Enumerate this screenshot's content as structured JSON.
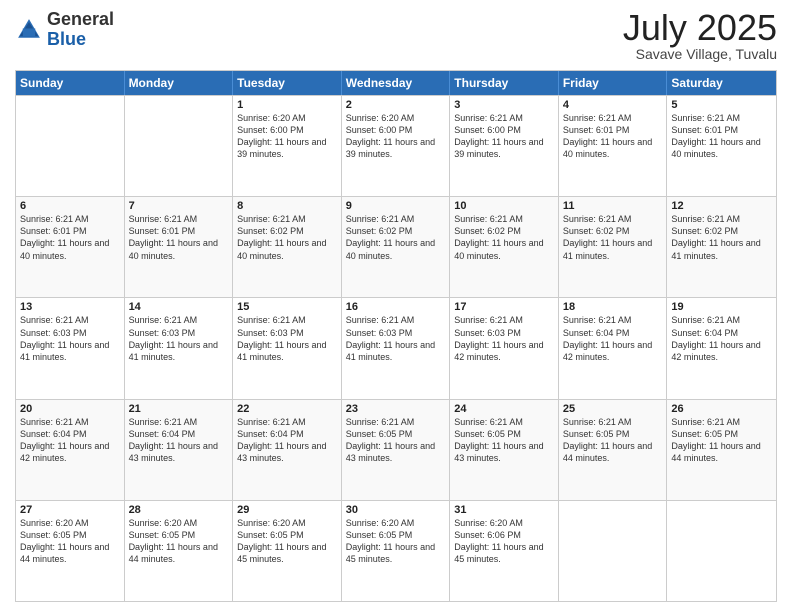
{
  "header": {
    "logo_general": "General",
    "logo_blue": "Blue",
    "month_year": "July 2025",
    "location": "Savave Village, Tuvalu"
  },
  "days_of_week": [
    "Sunday",
    "Monday",
    "Tuesday",
    "Wednesday",
    "Thursday",
    "Friday",
    "Saturday"
  ],
  "weeks": [
    [
      {
        "day": "",
        "sunrise": "",
        "sunset": "",
        "daylight": ""
      },
      {
        "day": "",
        "sunrise": "",
        "sunset": "",
        "daylight": ""
      },
      {
        "day": "1",
        "sunrise": "Sunrise: 6:20 AM",
        "sunset": "Sunset: 6:00 PM",
        "daylight": "Daylight: 11 hours and 39 minutes."
      },
      {
        "day": "2",
        "sunrise": "Sunrise: 6:20 AM",
        "sunset": "Sunset: 6:00 PM",
        "daylight": "Daylight: 11 hours and 39 minutes."
      },
      {
        "day": "3",
        "sunrise": "Sunrise: 6:21 AM",
        "sunset": "Sunset: 6:00 PM",
        "daylight": "Daylight: 11 hours and 39 minutes."
      },
      {
        "day": "4",
        "sunrise": "Sunrise: 6:21 AM",
        "sunset": "Sunset: 6:01 PM",
        "daylight": "Daylight: 11 hours and 40 minutes."
      },
      {
        "day": "5",
        "sunrise": "Sunrise: 6:21 AM",
        "sunset": "Sunset: 6:01 PM",
        "daylight": "Daylight: 11 hours and 40 minutes."
      }
    ],
    [
      {
        "day": "6",
        "sunrise": "Sunrise: 6:21 AM",
        "sunset": "Sunset: 6:01 PM",
        "daylight": "Daylight: 11 hours and 40 minutes."
      },
      {
        "day": "7",
        "sunrise": "Sunrise: 6:21 AM",
        "sunset": "Sunset: 6:01 PM",
        "daylight": "Daylight: 11 hours and 40 minutes."
      },
      {
        "day": "8",
        "sunrise": "Sunrise: 6:21 AM",
        "sunset": "Sunset: 6:02 PM",
        "daylight": "Daylight: 11 hours and 40 minutes."
      },
      {
        "day": "9",
        "sunrise": "Sunrise: 6:21 AM",
        "sunset": "Sunset: 6:02 PM",
        "daylight": "Daylight: 11 hours and 40 minutes."
      },
      {
        "day": "10",
        "sunrise": "Sunrise: 6:21 AM",
        "sunset": "Sunset: 6:02 PM",
        "daylight": "Daylight: 11 hours and 40 minutes."
      },
      {
        "day": "11",
        "sunrise": "Sunrise: 6:21 AM",
        "sunset": "Sunset: 6:02 PM",
        "daylight": "Daylight: 11 hours and 41 minutes."
      },
      {
        "day": "12",
        "sunrise": "Sunrise: 6:21 AM",
        "sunset": "Sunset: 6:02 PM",
        "daylight": "Daylight: 11 hours and 41 minutes."
      }
    ],
    [
      {
        "day": "13",
        "sunrise": "Sunrise: 6:21 AM",
        "sunset": "Sunset: 6:03 PM",
        "daylight": "Daylight: 11 hours and 41 minutes."
      },
      {
        "day": "14",
        "sunrise": "Sunrise: 6:21 AM",
        "sunset": "Sunset: 6:03 PM",
        "daylight": "Daylight: 11 hours and 41 minutes."
      },
      {
        "day": "15",
        "sunrise": "Sunrise: 6:21 AM",
        "sunset": "Sunset: 6:03 PM",
        "daylight": "Daylight: 11 hours and 41 minutes."
      },
      {
        "day": "16",
        "sunrise": "Sunrise: 6:21 AM",
        "sunset": "Sunset: 6:03 PM",
        "daylight": "Daylight: 11 hours and 41 minutes."
      },
      {
        "day": "17",
        "sunrise": "Sunrise: 6:21 AM",
        "sunset": "Sunset: 6:03 PM",
        "daylight": "Daylight: 11 hours and 42 minutes."
      },
      {
        "day": "18",
        "sunrise": "Sunrise: 6:21 AM",
        "sunset": "Sunset: 6:04 PM",
        "daylight": "Daylight: 11 hours and 42 minutes."
      },
      {
        "day": "19",
        "sunrise": "Sunrise: 6:21 AM",
        "sunset": "Sunset: 6:04 PM",
        "daylight": "Daylight: 11 hours and 42 minutes."
      }
    ],
    [
      {
        "day": "20",
        "sunrise": "Sunrise: 6:21 AM",
        "sunset": "Sunset: 6:04 PM",
        "daylight": "Daylight: 11 hours and 42 minutes."
      },
      {
        "day": "21",
        "sunrise": "Sunrise: 6:21 AM",
        "sunset": "Sunset: 6:04 PM",
        "daylight": "Daylight: 11 hours and 43 minutes."
      },
      {
        "day": "22",
        "sunrise": "Sunrise: 6:21 AM",
        "sunset": "Sunset: 6:04 PM",
        "daylight": "Daylight: 11 hours and 43 minutes."
      },
      {
        "day": "23",
        "sunrise": "Sunrise: 6:21 AM",
        "sunset": "Sunset: 6:05 PM",
        "daylight": "Daylight: 11 hours and 43 minutes."
      },
      {
        "day": "24",
        "sunrise": "Sunrise: 6:21 AM",
        "sunset": "Sunset: 6:05 PM",
        "daylight": "Daylight: 11 hours and 43 minutes."
      },
      {
        "day": "25",
        "sunrise": "Sunrise: 6:21 AM",
        "sunset": "Sunset: 6:05 PM",
        "daylight": "Daylight: 11 hours and 44 minutes."
      },
      {
        "day": "26",
        "sunrise": "Sunrise: 6:21 AM",
        "sunset": "Sunset: 6:05 PM",
        "daylight": "Daylight: 11 hours and 44 minutes."
      }
    ],
    [
      {
        "day": "27",
        "sunrise": "Sunrise: 6:20 AM",
        "sunset": "Sunset: 6:05 PM",
        "daylight": "Daylight: 11 hours and 44 minutes."
      },
      {
        "day": "28",
        "sunrise": "Sunrise: 6:20 AM",
        "sunset": "Sunset: 6:05 PM",
        "daylight": "Daylight: 11 hours and 44 minutes."
      },
      {
        "day": "29",
        "sunrise": "Sunrise: 6:20 AM",
        "sunset": "Sunset: 6:05 PM",
        "daylight": "Daylight: 11 hours and 45 minutes."
      },
      {
        "day": "30",
        "sunrise": "Sunrise: 6:20 AM",
        "sunset": "Sunset: 6:05 PM",
        "daylight": "Daylight: 11 hours and 45 minutes."
      },
      {
        "day": "31",
        "sunrise": "Sunrise: 6:20 AM",
        "sunset": "Sunset: 6:06 PM",
        "daylight": "Daylight: 11 hours and 45 minutes."
      },
      {
        "day": "",
        "sunrise": "",
        "sunset": "",
        "daylight": ""
      },
      {
        "day": "",
        "sunrise": "",
        "sunset": "",
        "daylight": ""
      }
    ]
  ]
}
